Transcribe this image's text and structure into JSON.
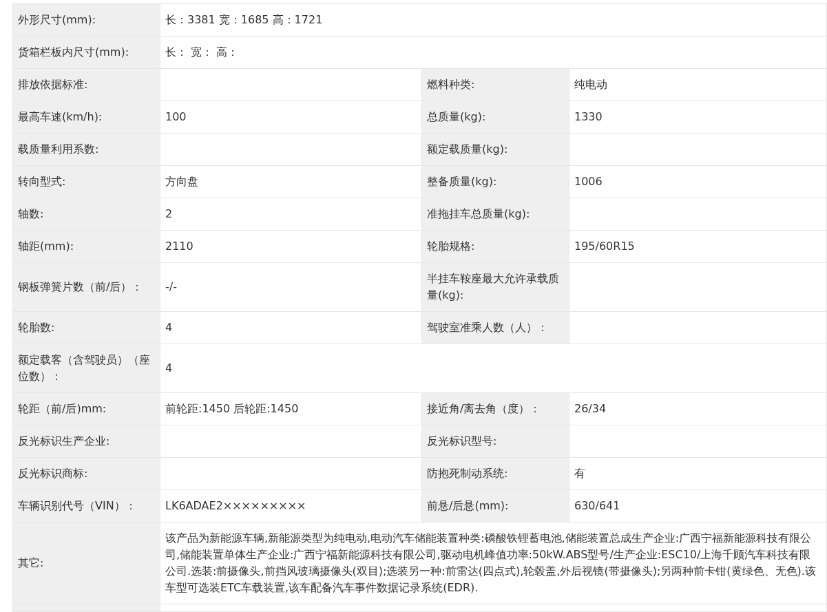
{
  "spec_table": {
    "rows": [
      {
        "pairs": [
          {
            "label": "外形尺寸(mm):",
            "value": "长：3381 宽：1685 高：1721"
          }
        ]
      },
      {
        "pairs": [
          {
            "label": "货箱栏板内尺寸(mm):",
            "value": "长：  宽：  高："
          }
        ]
      },
      {
        "pairs": [
          {
            "label": "排放依据标准:"
          },
          {
            "label": "燃料种类:",
            "value": "纯电动"
          }
        ]
      },
      {
        "pairs": [
          {
            "label": "最高车速(km/h):",
            "value": "100"
          },
          {
            "label": "总质量(kg):",
            "value": "1330"
          }
        ]
      },
      {
        "pairs": [
          {
            "label": "载质量利用系数:"
          },
          {
            "label": "额定载质量(kg):"
          }
        ]
      },
      {
        "pairs": [
          {
            "label": "转向型式:",
            "value": "方向盘"
          },
          {
            "label": "整备质量(kg):",
            "value": "1006"
          }
        ]
      },
      {
        "pairs": [
          {
            "label": "轴数:",
            "value": "2"
          },
          {
            "label": "准拖挂车总质量(kg):"
          }
        ]
      },
      {
        "pairs": [
          {
            "label": "轴距(mm):",
            "value": "2110"
          },
          {
            "label": "轮胎规格:",
            "value": "195/60R15"
          }
        ]
      },
      {
        "pairs": [
          {
            "label": "钢板弹簧片数（前/后）：",
            "value": "-/-"
          },
          {
            "label": "半挂车鞍座最大允许承载质量(kg):"
          }
        ]
      },
      {
        "pairs": [
          {
            "label": "轮胎数:",
            "value": "4"
          },
          {
            "label": "驾驶室准乘人数（人）："
          }
        ]
      },
      {
        "pairs": [
          {
            "label": "额定载客（含驾驶员）（座位数）：",
            "value": "4"
          }
        ]
      },
      {
        "pairs": [
          {
            "label": "轮距（前/后)mm:",
            "value": "前轮距:1450 后轮距:1450"
          },
          {
            "label": "接近角/离去角（度）：",
            "value": "26/34"
          }
        ]
      },
      {
        "pairs": [
          {
            "label": "反光标识生产企业:"
          },
          {
            "label": "反光标识型号:"
          }
        ]
      },
      {
        "pairs": [
          {
            "label": "反光标识商标:"
          },
          {
            "label": "防抱死制动系统:",
            "value": "有"
          }
        ]
      },
      {
        "pairs": [
          {
            "label": "车辆识别代号（VIN）：",
            "value": "LK6ADAE2×××××××××"
          },
          {
            "label": "前悬/后悬(mm):",
            "value": "630/641"
          }
        ]
      },
      {
        "pairs": [
          {
            "label": "其它:",
            "value": "该产品为新能源车辆,新能源类型为纯电动,电动汽车储能装置种类:磷酸铁锂蓄电池,储能装置总成生产企业:广西宁福新能源科技有限公司,储能装置单体生产企业:广西宁福新能源科技有限公司,驱动电机峰值功率:50kW.ABS型号/生产企业:ESC10/上海千顾汽车科技有限公司.选装:前摄像头,前挡风玻璃摄像头(双目);选装另一种:前雷达(四点式),轮毂盖,外后视镜(带摄像头);另两种前卡钳(黄绿色、无色).该车型可选装ETC车载装置,该车配备汽车事件数据记录系统(EDR)."
          }
        ]
      }
    ]
  }
}
